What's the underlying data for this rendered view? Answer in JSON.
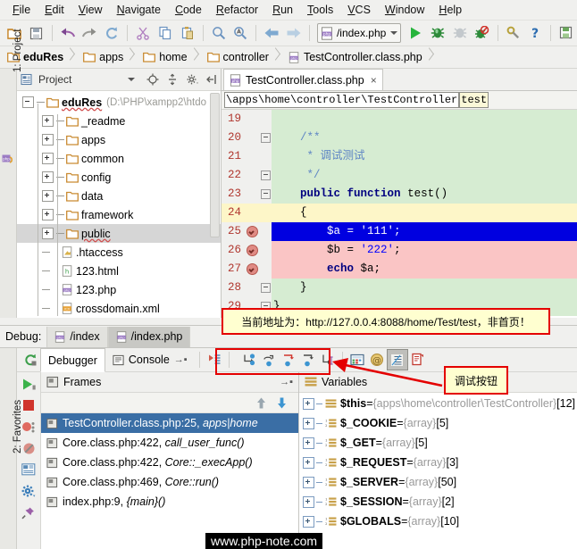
{
  "menubar": {
    "items": [
      "File",
      "Edit",
      "View",
      "Navigate",
      "Code",
      "Refactor",
      "Run",
      "Tools",
      "VCS",
      "Window",
      "Help"
    ]
  },
  "toolbar": {
    "run_config": "/index.php",
    "icons": [
      "open-folder-icon",
      "save-all-icon",
      "undo-icon",
      "redo-icon",
      "refresh-icon",
      "cut-icon",
      "copy-icon",
      "paste-icon",
      "find-icon",
      "replace-icon",
      "back-icon",
      "forward-icon",
      "run-icon",
      "debug-icon",
      "coverage-icon",
      "stop-debug-icon",
      "settings-wrench-icon",
      "help-icon",
      "deploy-icon"
    ]
  },
  "breadcrumb": {
    "items": [
      {
        "label": "eduRes",
        "icon": "folder-icon",
        "bold": true
      },
      {
        "label": "apps",
        "icon": "folder-icon",
        "bold": false
      },
      {
        "label": "home",
        "icon": "folder-icon",
        "bold": false
      },
      {
        "label": "controller",
        "icon": "folder-icon",
        "bold": false
      },
      {
        "label": "TestController.class.php",
        "icon": "php-file-icon",
        "bold": false
      }
    ]
  },
  "left_rail": {
    "label": "1: Project",
    "php_tab": "php"
  },
  "bottom_rail": {
    "label": "2: Favorites"
  },
  "project": {
    "title": "Project",
    "tools": [
      "target-icon",
      "collapse-all-icon",
      "gear-icon",
      "hide-icon"
    ],
    "tree": [
      {
        "label": "eduRes",
        "suffix": "(D:\\PHP\\xampp2\\htdo",
        "icon": "folder-icon",
        "depth": 0,
        "expander": "minus",
        "selected": false,
        "squiggle": true
      },
      {
        "label": "_readme",
        "suffix": "",
        "icon": "folder-icon",
        "depth": 1,
        "expander": "plus",
        "selected": false,
        "squiggle": false
      },
      {
        "label": "apps",
        "suffix": "",
        "icon": "folder-icon",
        "depth": 1,
        "expander": "plus",
        "selected": false,
        "squiggle": false
      },
      {
        "label": "common",
        "suffix": "",
        "icon": "folder-icon",
        "depth": 1,
        "expander": "plus",
        "selected": false,
        "squiggle": false
      },
      {
        "label": "config",
        "suffix": "",
        "icon": "folder-icon",
        "depth": 1,
        "expander": "plus",
        "selected": false,
        "squiggle": false
      },
      {
        "label": "data",
        "suffix": "",
        "icon": "folder-icon",
        "depth": 1,
        "expander": "plus",
        "selected": false,
        "squiggle": false
      },
      {
        "label": "framework",
        "suffix": "",
        "icon": "folder-icon",
        "depth": 1,
        "expander": "plus",
        "selected": false,
        "squiggle": false
      },
      {
        "label": "public",
        "suffix": "",
        "icon": "folder-icon",
        "depth": 1,
        "expander": "plus",
        "selected": true,
        "squiggle": true
      },
      {
        "label": ".htaccess",
        "suffix": "",
        "icon": "htaccess-file-icon",
        "depth": 1,
        "expander": "none",
        "selected": false,
        "squiggle": false
      },
      {
        "label": "123.html",
        "suffix": "",
        "icon": "html-file-icon",
        "depth": 1,
        "expander": "none",
        "selected": false,
        "squiggle": false
      },
      {
        "label": "123.php",
        "suffix": "",
        "icon": "php-file-icon",
        "depth": 1,
        "expander": "none",
        "selected": false,
        "squiggle": false
      },
      {
        "label": "crossdomain.xml",
        "suffix": "",
        "icon": "xml-file-icon",
        "depth": 1,
        "expander": "none",
        "selected": false,
        "squiggle": false
      }
    ]
  },
  "editor": {
    "tab": {
      "label": "TestController.class.php",
      "icon": "php-file-icon",
      "close": "×"
    },
    "nav": {
      "path": "\\apps\\home\\controller\\TestController",
      "member": "test"
    },
    "lines": [
      {
        "num": "19",
        "text": "",
        "bg": "green",
        "breakpoint": false,
        "fold": "none",
        "highlight": false
      },
      {
        "num": "20",
        "text": "/**",
        "bg": "green",
        "breakpoint": false,
        "fold": "minus",
        "highlight": false,
        "cls": "doc"
      },
      {
        "num": "21",
        "text": " * 调试测试",
        "bg": "green",
        "breakpoint": false,
        "fold": "none",
        "highlight": false,
        "cls": "doc"
      },
      {
        "num": "22",
        "text": " */",
        "bg": "green",
        "breakpoint": false,
        "fold": "minus",
        "highlight": false,
        "cls": "doc"
      },
      {
        "num": "23",
        "text": "public function test()",
        "bg": "green",
        "breakpoint": false,
        "fold": "minus",
        "highlight": false,
        "cls": "code"
      },
      {
        "num": "24",
        "text": "{",
        "bg": "yellow",
        "breakpoint": false,
        "fold": "none",
        "highlight": true,
        "cls": "code"
      },
      {
        "num": "25",
        "text": "$a = '111';",
        "bg": "blue",
        "breakpoint": true,
        "fold": "none",
        "highlight": false,
        "cls": "code"
      },
      {
        "num": "26",
        "text": "$b = '222';",
        "bg": "pink",
        "breakpoint": true,
        "fold": "none",
        "highlight": false,
        "cls": "code"
      },
      {
        "num": "27",
        "text": "echo $a;",
        "bg": "pink",
        "breakpoint": true,
        "fold": "none",
        "highlight": false,
        "cls": "code"
      },
      {
        "num": "28",
        "text": "}",
        "bg": "green",
        "breakpoint": false,
        "fold": "minus",
        "highlight": false,
        "cls": "code"
      },
      {
        "num": "29",
        "text": "}",
        "bg": "green",
        "breakpoint": false,
        "fold": "minus",
        "highlight": false,
        "cls": "code"
      }
    ]
  },
  "annotations": {
    "url_note": "当前地址为：http://127.0.0.4:8088/home/Test/test，非首页！",
    "debug_buttons_note": "调试按钮"
  },
  "debug": {
    "label": "Debug:",
    "session_tabs": [
      {
        "label": "/index",
        "icon": "php-file-icon",
        "active": false
      },
      {
        "label": "/index.php",
        "icon": "php-file-icon",
        "active": true
      }
    ],
    "rerun_icon": "rerun-icon",
    "tabs": [
      {
        "label": "Debugger",
        "icon": "",
        "active": true
      },
      {
        "label": "Console",
        "icon": "console-icon",
        "active": false
      }
    ],
    "step_buttons": [
      "show-execution-point-icon",
      "step-over-icon",
      "step-into-icon",
      "force-step-into-icon",
      "step-out-icon"
    ],
    "extra_buttons": [
      "evaluate-expression-icon",
      "mute-breakpoints-icon",
      "view-breakpoints-icon",
      "settings-icon"
    ],
    "side_buttons": [
      "resume-icon",
      "stop-icon",
      "view-breakpoints-icon",
      "mute-breakpoints-icon",
      "layout-icon",
      "settings-gear-icon",
      "pin-icon"
    ],
    "frames": {
      "title": "Frames",
      "icon": "frames-icon",
      "items": [
        {
          "text": "TestController.class.php:25, ",
          "italic": "apps|home",
          "selected": true
        },
        {
          "text": "Core.class.php:422, ",
          "italic": "call_user_func()",
          "selected": false
        },
        {
          "text": "Core.class.php:422, ",
          "italic": "Core::_execApp()",
          "selected": false
        },
        {
          "text": "Core.class.php:469, ",
          "italic": "Core::run()",
          "selected": false
        },
        {
          "text": "index.php:9, ",
          "italic": "{main}()",
          "selected": false
        }
      ]
    },
    "variables": {
      "title": "Variables",
      "icon": "variables-icon",
      "items": [
        {
          "name": "$this",
          "value": "{apps\\home\\controller\\TestController}",
          "count": "[12]",
          "icon": "object-icon"
        },
        {
          "name": "$_COOKIE",
          "value": "{array}",
          "count": "[5]",
          "icon": "array-icon"
        },
        {
          "name": "$_GET",
          "value": "{array}",
          "count": "[5]",
          "icon": "array-icon"
        },
        {
          "name": "$_REQUEST",
          "value": "{array}",
          "count": "[3]",
          "icon": "array-icon"
        },
        {
          "name": "$_SERVER",
          "value": "{array}",
          "count": "[50]",
          "icon": "array-icon"
        },
        {
          "name": "$_SESSION",
          "value": "{array}",
          "count": "[2]",
          "icon": "array-icon"
        },
        {
          "name": "$GLOBALS",
          "value": "{array}",
          "count": "[10]",
          "icon": "array-icon"
        }
      ]
    }
  },
  "watermark": "www.php-note.com",
  "colors": {
    "accent_red": "#e40000",
    "callout_bg": "#ffffd0",
    "selection_blue": "#3a6ea5",
    "exec_line_blue": "#0000e0",
    "breakpoint_pink": "#fac5c5",
    "fold_green": "#d6ecd2",
    "caret_line_yellow": "#fdf6c8"
  }
}
